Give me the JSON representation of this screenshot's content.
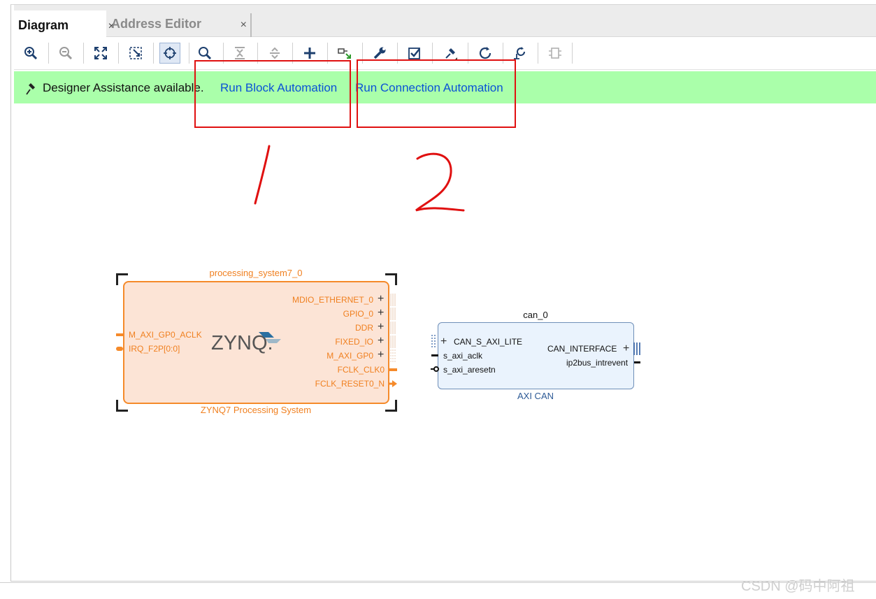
{
  "tabs": [
    {
      "label": "Diagram",
      "active": true
    },
    {
      "label": "Address Editor",
      "active": false
    }
  ],
  "close_glyph": "×",
  "toolbar": {
    "icons": [
      "zoom-in-icon",
      "zoom-out-icon",
      "fit-view-icon",
      "zoom-area-icon",
      "regenerate-icon",
      "search-icon",
      "collapse-all-icon",
      "expand-all-icon",
      "add-ip-icon",
      "make-connection-icon",
      "properties-icon",
      "validate-icon",
      "auto-connect-icon",
      "refresh-icon",
      "optimize-routing-icon",
      "hierarchy-icon"
    ]
  },
  "banner": {
    "message": "Designer Assistance available.",
    "run_block_automation": "Run Block Automation",
    "run_connection_automation": "Run Connection Automation"
  },
  "annotations": {
    "one": "1",
    "two": "2"
  },
  "zynq": {
    "instance_name": "processing_system7_0",
    "display_name": "ZYNQ7 Processing System",
    "logo_text": "ZYNQ.",
    "left_ports": [
      "M_AXI_GP0_ACLK",
      "IRQ_F2P[0:0]"
    ],
    "right_ports": [
      "MDIO_ETHERNET_0",
      "GPIO_0",
      "DDR",
      "FIXED_IO",
      "M_AXI_GP0",
      "FCLK_CLK0",
      "FCLK_RESET0_N"
    ],
    "plus_glyph": "+"
  },
  "can": {
    "instance_name": "can_0",
    "display_name": "AXI CAN",
    "left_ports": [
      "CAN_S_AXI_LITE",
      "s_axi_aclk",
      "s_axi_aresetn"
    ],
    "right_ports": [
      "CAN_INTERFACE",
      "ip2bus_intrevent"
    ]
  },
  "watermark": "CSDN @码中阿祖",
  "colors": {
    "banner_bg": "#aaffaa",
    "link": "#0a52d6",
    "zynq_fill": "#fce4d6",
    "zynq_border": "#f58a2a",
    "can_fill": "#eaf3fd",
    "can_border": "#6f8fb8",
    "annotation_red": "#e01010"
  }
}
